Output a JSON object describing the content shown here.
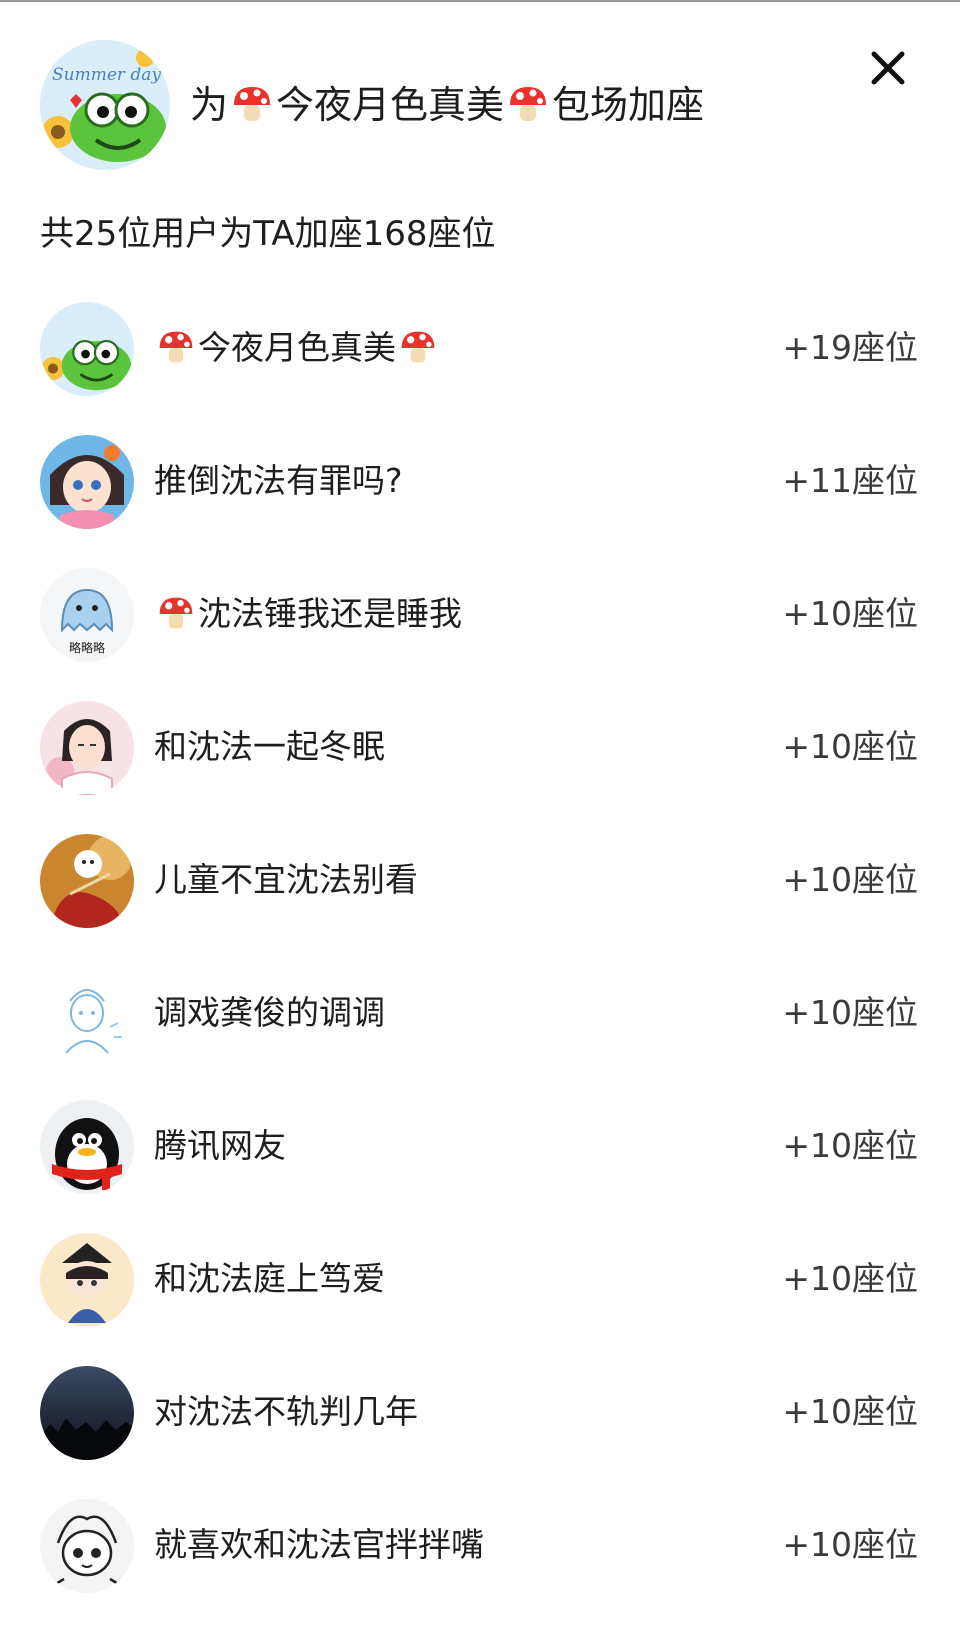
{
  "header": {
    "title_prefix": "为",
    "title_name": "今夜月色真美",
    "title_suffix": "包场加座",
    "avatar_text": "Summer day",
    "close_icon": "close-icon"
  },
  "summary": {
    "text": "共25位用户为TA加座168座位"
  },
  "list": [
    {
      "name": "今夜月色真美",
      "seats": "+19座位",
      "avatar": "frog-avatar",
      "mushroom": "both"
    },
    {
      "name": "推倒沈法有罪吗?",
      "seats": "+11座位",
      "avatar": "anime-girl-avatar",
      "mushroom": "none"
    },
    {
      "name": "沈法锤我还是睡我",
      "seats": "+10座位",
      "avatar": "blue-ghost-avatar",
      "avatar_caption": "略略略",
      "mushroom": "before"
    },
    {
      "name": "和沈法一起冬眠",
      "seats": "+10座位",
      "avatar": "guofeng-boy-avatar",
      "mushroom": "none"
    },
    {
      "name": "儿童不宜沈法别看",
      "seats": "+10座位",
      "avatar": "puppy-avatar",
      "mushroom": "none"
    },
    {
      "name": "调戏龚俊的调调",
      "seats": "+10座位",
      "avatar": "sketch-boy-avatar",
      "mushroom": "none"
    },
    {
      "name": "腾讯网友",
      "seats": "+10座位",
      "avatar": "penguin-avatar",
      "mushroom": "none"
    },
    {
      "name": "和沈法庭上笃爱",
      "seats": "+10座位",
      "avatar": "chibi-avatar",
      "mushroom": "none"
    },
    {
      "name": "对沈法不轨判几年",
      "seats": "+10座位",
      "avatar": "night-sky-avatar",
      "mushroom": "none"
    },
    {
      "name": "就喜欢和沈法官拌拌嘴",
      "seats": "+10座位",
      "avatar": "lineart-boy-avatar",
      "mushroom": "none"
    }
  ],
  "colors": {
    "text": "#1e1e1e",
    "mushroom_cap": "#e8322c",
    "mushroom_stem": "#f3dcb5",
    "divider": "#9a9a9a"
  }
}
